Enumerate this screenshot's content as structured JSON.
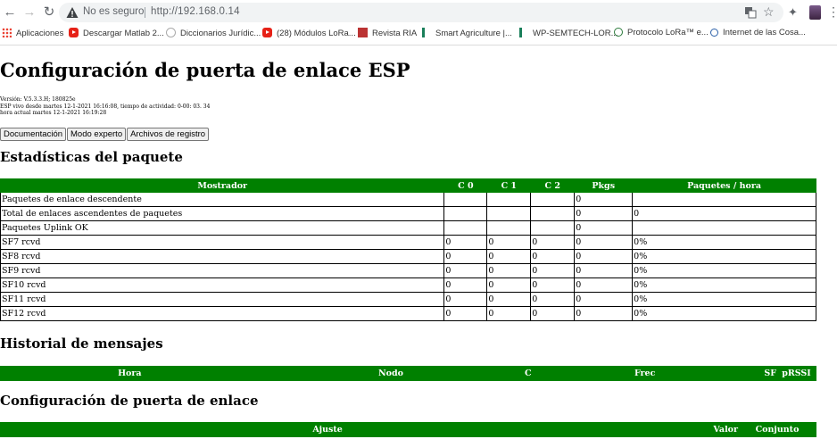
{
  "browser": {
    "security_label": "No es seguro",
    "url": "http://192.168.0.14",
    "bookmarks": [
      {
        "label": "Aplicaciones",
        "icon": "apps-grid-icon"
      },
      {
        "label": "Descargar Matlab 2...",
        "icon": "youtube-icon"
      },
      {
        "label": "Diccionarios Jurídic...",
        "icon": "dictionary-icon"
      },
      {
        "label": "(28) Módulos LoRa...",
        "icon": "youtube-icon"
      },
      {
        "label": "Revista RIA",
        "icon": "ria-icon"
      },
      {
        "label": "Smart Agriculture |...",
        "icon": "flag-icon"
      },
      {
        "label": "WP-SEMTECH-LOR...",
        "icon": "flag-icon"
      },
      {
        "label": "Protocolo LoRa™ e...",
        "icon": "lora-icon"
      },
      {
        "label": "Internet de las Cosa...",
        "icon": "iot-icon"
      }
    ]
  },
  "page": {
    "title": "Configuración de puerta de enlace ESP",
    "info_lines": [
      "Versión: V.5.3.3.H; 180825e",
      "ESP vivo desde martes 12-1-2021 16:16:08, tiempo de actividad: 0-00: 03. 34",
      "hora actual martes 12-1-2021 16:19:28"
    ],
    "buttons": {
      "docs": "Documentación",
      "expert": "Modo experto",
      "logs": "Archivos de registro"
    }
  },
  "stats": {
    "title": "Estadísticas del paquete",
    "headers": [
      "Mostrador",
      "C 0",
      "C 1",
      "C 2",
      "Pkgs",
      "Paquetes / hora"
    ],
    "rows": [
      [
        "Paquetes de enlace descendente",
        "",
        "",
        "",
        "0",
        ""
      ],
      [
        "Total de enlaces ascendentes de paquetes",
        "",
        "",
        "",
        "0",
        "0"
      ],
      [
        "Paquetes Uplink OK",
        "",
        "",
        "",
        "0",
        ""
      ],
      [
        "SF7 rcvd",
        "0",
        "0",
        "0",
        "0",
        "0%"
      ],
      [
        "SF8 rcvd",
        "0",
        "0",
        "0",
        "0",
        "0%"
      ],
      [
        "SF9 rcvd",
        "0",
        "0",
        "0",
        "0",
        "0%"
      ],
      [
        "SF10 rcvd",
        "0",
        "0",
        "0",
        "0",
        "0%"
      ],
      [
        "SF11 rcvd",
        "0",
        "0",
        "0",
        "0",
        "0%"
      ],
      [
        "SF12 rcvd",
        "0",
        "0",
        "0",
        "0",
        "0%"
      ]
    ]
  },
  "history": {
    "title": "Historial de mensajes",
    "headers": [
      "Hora",
      "Nodo",
      "C",
      "Frec",
      "SF",
      "pRSSI"
    ]
  },
  "gateway": {
    "title": "Configuración de puerta de enlace",
    "headers": [
      "Ajuste",
      "Valor",
      "Conjunto"
    ]
  },
  "colors": {
    "header_green": "#008000",
    "warning_red": "#c5221f"
  }
}
